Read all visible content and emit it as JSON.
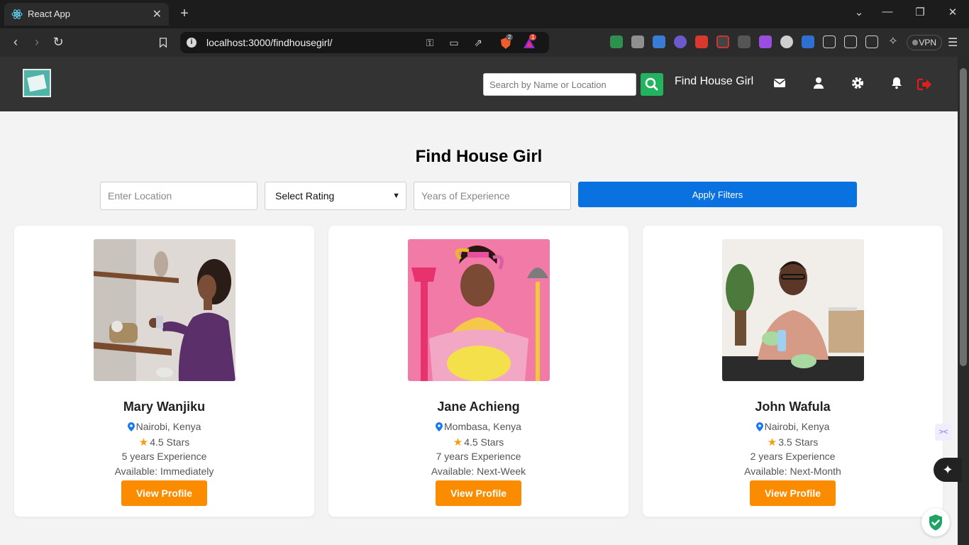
{
  "browser": {
    "tab_title": "React App",
    "url": "localhost:3000/findhousegirl/",
    "vpn_label": "VPN",
    "brave_badge": "2",
    "alert_badge": "1"
  },
  "header": {
    "search_placeholder": "Search by Name or Location",
    "brand_link": "Find House Girl"
  },
  "page": {
    "title": "Find House Girl"
  },
  "filters": {
    "location_placeholder": "Enter Location",
    "rating_selected": "Select Rating",
    "experience_placeholder": "Years of Experience",
    "apply_label": "Apply Filters"
  },
  "cards": [
    {
      "name": "Mary Wanjiku",
      "location": "Nairobi, Kenya",
      "rating": "4.5 Stars",
      "experience": "5 years Experience",
      "availability": "Available: Immediately",
      "button": "View Profile"
    },
    {
      "name": "Jane Achieng",
      "location": "Mombasa, Kenya",
      "rating": "4.5 Stars",
      "experience": "7 years Experience",
      "availability": "Available: Next-Week",
      "button": "View Profile"
    },
    {
      "name": "John Wafula",
      "location": "Nairobi, Kenya",
      "rating": "3.5 Stars",
      "experience": "2 years Experience",
      "availability": "Available: Next-Month",
      "button": "View Profile"
    }
  ],
  "colors": {
    "header_bg": "#333333",
    "search_button": "#22b35e",
    "apply_button": "#0a72e0",
    "view_button": "#fb8c00",
    "logout_icon": "#e11d1d"
  }
}
